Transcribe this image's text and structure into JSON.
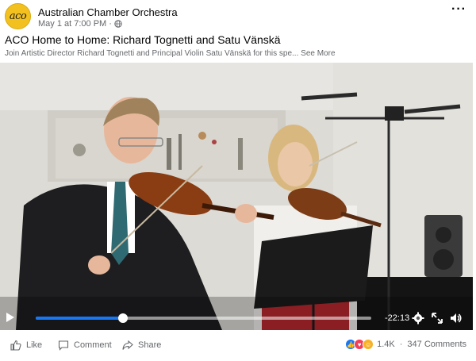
{
  "post": {
    "page_name": "Australian Chamber Orchestra",
    "avatar_text": "aco",
    "timestamp": "May 1 at 7:00 PM",
    "separator": "·",
    "title": "ACO Home to Home: Richard Tognetti and Satu Vänskä",
    "description": "Join Artistic Director Richard Tognetti and Principal Violin Satu Vänskä for this spe...",
    "see_more": "See More",
    "more_label": "···"
  },
  "video": {
    "remaining_time": "-22:13",
    "progress_fraction": 0.26
  },
  "footer": {
    "like_label": "Like",
    "comment_label": "Comment",
    "share_label": "Share",
    "reaction_count": "1.4K",
    "comments_count": "347 Comments"
  },
  "colors": {
    "accent": "#1877f2",
    "avatar": "#f3c11f"
  },
  "icons": [
    "globe-icon",
    "more-icon",
    "play-icon",
    "settings-icon",
    "fullscreen-icon",
    "volume-icon",
    "like-icon",
    "comment-icon",
    "share-icon"
  ]
}
